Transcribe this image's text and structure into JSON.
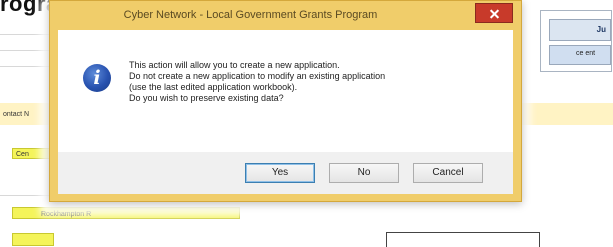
{
  "background": {
    "heading": "rogram",
    "fields": [
      "ontact N",
      "Cen",
      "Rockhampton R"
    ],
    "right_panel": {
      "top_label": "Ju",
      "bar_label": "ce ent"
    }
  },
  "dialog": {
    "title": "Cyber Network - Local Government Grants Program",
    "message_lines": [
      "This action will allow you to create a new application.",
      "Do not create a new application to modify an existing application",
      "(use the last edited application workbook).",
      "Do you wish to preserve existing data?"
    ],
    "icon": "info-icon",
    "buttons": {
      "yes": "Yes",
      "no": "No",
      "cancel": "Cancel"
    }
  },
  "colors": {
    "frame": "#f0cd6a",
    "close": "#c83a2a",
    "icon": "#2852b0",
    "field_yellow": "#f4f45a",
    "field_cream": "#fff3c4"
  }
}
